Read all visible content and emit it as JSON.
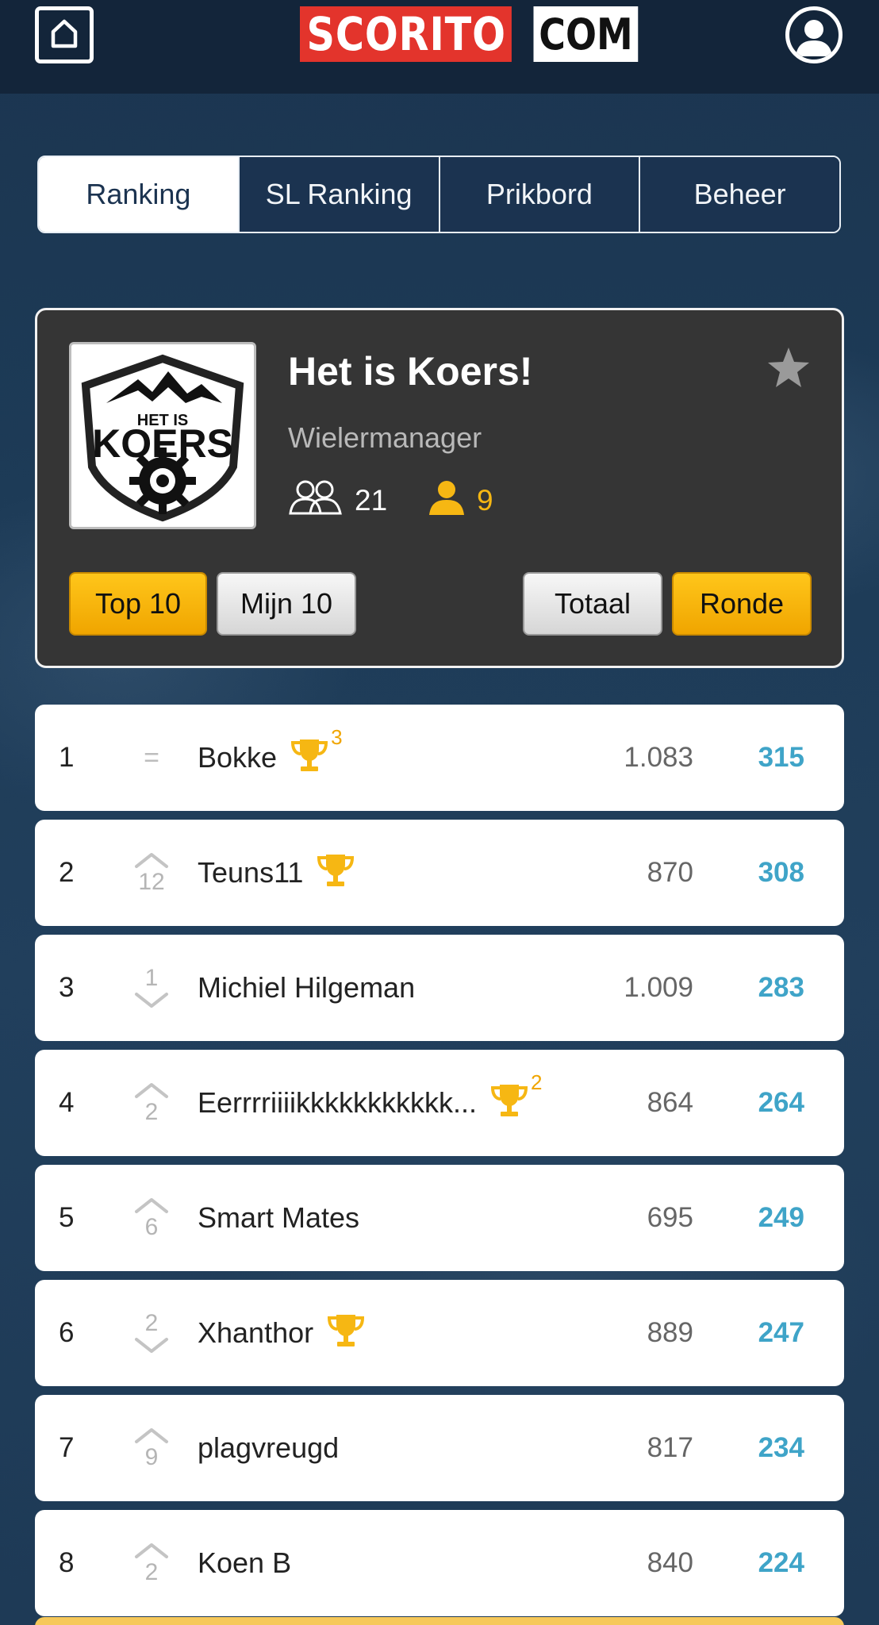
{
  "header": {
    "logo_left": "SCORITO",
    "logo_right": "COM"
  },
  "tabs": [
    {
      "label": "Ranking",
      "active": true
    },
    {
      "label": "SL Ranking",
      "active": false
    },
    {
      "label": "Prikbord",
      "active": false
    },
    {
      "label": "Beheer",
      "active": false
    }
  ],
  "league": {
    "logo_small": "HET IS",
    "logo_big": "KOERS",
    "title": "Het is Koers!",
    "subtitle": "Wielermanager",
    "members_count": "21",
    "my_count": "9",
    "buttons": {
      "top10": "Top 10",
      "mijn10": "Mijn 10",
      "totaal": "Totaal",
      "ronde": "Ronde"
    }
  },
  "colors": {
    "accent_yellow": "#f6b713",
    "score_blue": "#3fa4c8",
    "header_bg": "#13253a",
    "card_bg": "#353535"
  },
  "rankings": [
    {
      "rank": "1",
      "movement": "same",
      "change": "=",
      "name": "Bokke",
      "trophy": true,
      "trophy_count": "3",
      "total": "1.083",
      "score": "315"
    },
    {
      "rank": "2",
      "movement": "up",
      "change": "12",
      "name": "Teuns11",
      "trophy": true,
      "trophy_count": "",
      "total": "870",
      "score": "308"
    },
    {
      "rank": "3",
      "movement": "down",
      "change": "1",
      "name": "Michiel Hilgeman",
      "trophy": false,
      "trophy_count": "",
      "total": "1.009",
      "score": "283"
    },
    {
      "rank": "4",
      "movement": "up",
      "change": "2",
      "name": "Eerrrriiiikkkkkkkkkkk...",
      "trophy": true,
      "trophy_count": "2",
      "total": "864",
      "score": "264"
    },
    {
      "rank": "5",
      "movement": "up",
      "change": "6",
      "name": "Smart Mates",
      "trophy": false,
      "trophy_count": "",
      "total": "695",
      "score": "249"
    },
    {
      "rank": "6",
      "movement": "down",
      "change": "2",
      "name": "Xhanthor",
      "trophy": true,
      "trophy_count": "",
      "total": "889",
      "score": "247"
    },
    {
      "rank": "7",
      "movement": "up",
      "change": "9",
      "name": "plagvreugd",
      "trophy": false,
      "trophy_count": "",
      "total": "817",
      "score": "234"
    },
    {
      "rank": "8",
      "movement": "up",
      "change": "2",
      "name": "Koen B",
      "trophy": false,
      "trophy_count": "",
      "total": "840",
      "score": "224"
    }
  ]
}
